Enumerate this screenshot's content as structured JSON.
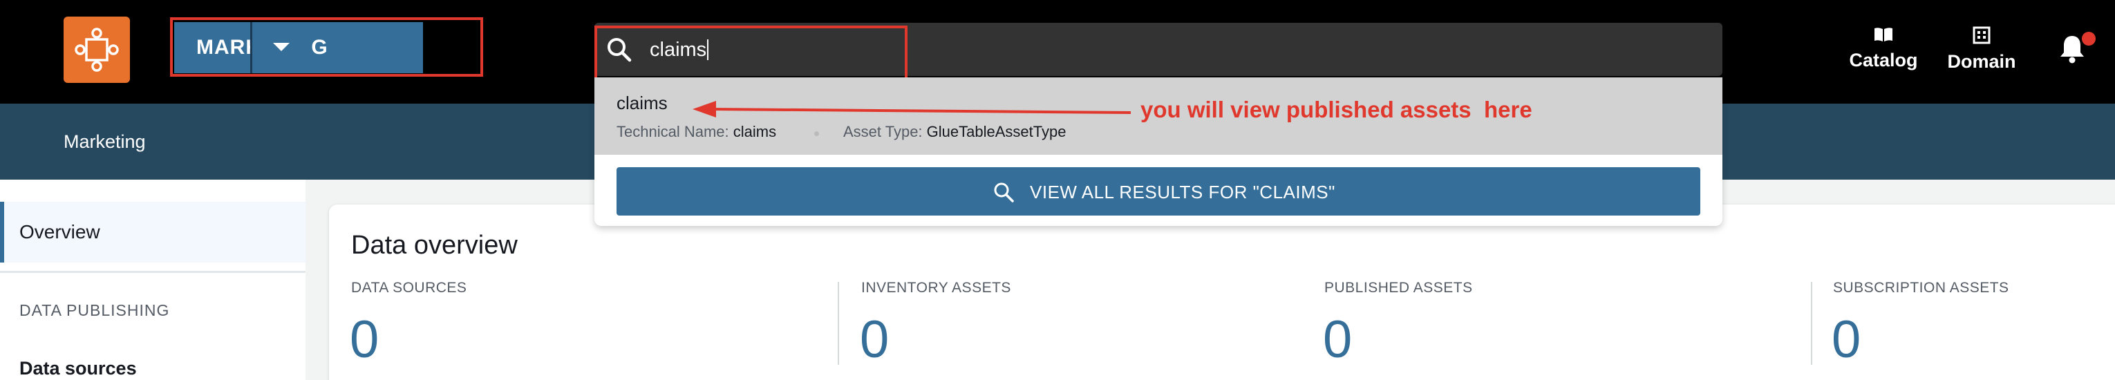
{
  "header": {
    "domain_name": "MARKETING",
    "search_value": "claims",
    "nav": [
      {
        "label": "Catalog",
        "icon": "book-icon"
      },
      {
        "label": "Domain",
        "icon": "building-icon"
      }
    ],
    "notification_icon": "bell-icon"
  },
  "search_results": {
    "items": [
      {
        "title": "claims",
        "technical_name_label": "Technical Name:",
        "technical_name": "claims",
        "asset_type_label": "Asset Type:",
        "asset_type": "GlueTableAssetType"
      }
    ],
    "view_all_label": "VIEW ALL RESULTS FOR \"CLAIMS\""
  },
  "subheader": {
    "title": "Marketing"
  },
  "sidebar": {
    "items": [
      {
        "label": "Overview",
        "active": true
      }
    ],
    "section_label": "DATA PUBLISHING",
    "section_items": [
      {
        "label": "Data sources"
      }
    ]
  },
  "overview": {
    "title": "Data overview",
    "metrics": [
      {
        "label": "DATA SOURCES",
        "value": "0"
      },
      {
        "label": "INVENTORY ASSETS",
        "value": "0"
      },
      {
        "label": "PUBLISHED ASSETS",
        "value": "0"
      },
      {
        "label": "SUBSCRIPTION ASSETS",
        "value": "0"
      }
    ]
  },
  "annotation": {
    "text": "you will view published assets  here"
  },
  "colors": {
    "brand_orange": "#e8712c",
    "primary_blue": "#356f99",
    "annotation_red": "#e0382d",
    "topbar_black": "#000000",
    "subheader_navy": "#26495f"
  }
}
